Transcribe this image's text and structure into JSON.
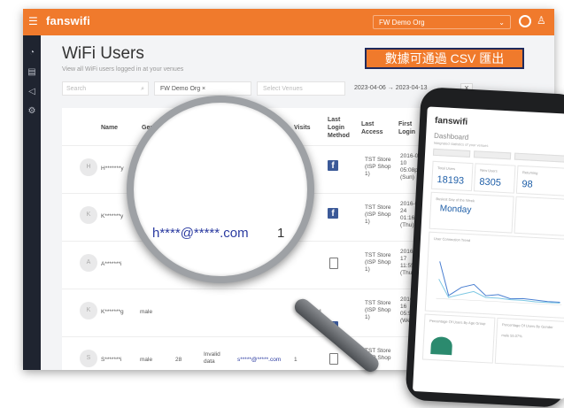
{
  "colors": {
    "brand": "#f07a2c",
    "sidebar": "#1f2430",
    "link": "#2a3aa0",
    "facebook": "#3b5998"
  },
  "topbar": {
    "brand": "fanswifi",
    "org_select": "FW Demo Org",
    "icons": [
      "menu-icon",
      "globe-icon",
      "user-icon"
    ]
  },
  "page": {
    "title": "WiFi Users",
    "subtitle": "View all WiFi users logged in at your venues"
  },
  "banner": "數據可通過 CSV 匯出",
  "filters": {
    "search_placeholder": "Search",
    "org_chip": "FW Demo Org ×",
    "venues_placeholder": "Select Venues",
    "date_range": "2023-04-06 → 2023-04-13",
    "clear": "X"
  },
  "table": {
    "headers": [
      "Name",
      "Gender",
      "Visits",
      "Last Login Method",
      "Last Access",
      "First Login"
    ],
    "rows": [
      {
        "avatar": "H",
        "name": "H*******y",
        "last_access": "TST Store (ISP Shop 1)",
        "first_login": "2016-04-10 05:08pm (Sun)",
        "method": "facebook"
      },
      {
        "avatar": "K",
        "name": "K*******y",
        "last_access": "TST Store (ISP Shop 1)",
        "first_login": "2016-03-24 01:16pm (Thu)",
        "method": "facebook"
      },
      {
        "avatar": "A",
        "name": "A*******i",
        "last_access": "TST Store (ISP Shop 1)",
        "first_login": "2016-03-17 11:55am (Thu)",
        "method": "form"
      },
      {
        "avatar": "K",
        "name": "K*******g",
        "gender": "male",
        "visits": "1",
        "last_access": "TST Store (ISP Shop 1)",
        "first_login": "2016-03-16 05:54pm (Wed)",
        "method": "facebook"
      },
      {
        "avatar": "S",
        "name": "S*******i",
        "gender": "male",
        "age": "28",
        "email_status": "Invalid data",
        "email": "s*****@*****.com",
        "visits": "1",
        "last_access": "TST Store (ISP Shop 1)",
        "method": "form"
      }
    ]
  },
  "magnifier": {
    "email": "h****@*****.com",
    "visits": "1"
  },
  "phone": {
    "brand": "fanswifi",
    "title": "Dashboard",
    "subtitle": "Integrated statistics of your venues",
    "stats": [
      {
        "label": "Total Users",
        "value": "18193"
      },
      {
        "label": "New Users",
        "value": "8305"
      },
      {
        "label": "Returning",
        "value": "98"
      }
    ],
    "busiest_label": "Busiest Day of the Week",
    "busiest_value": "Monday",
    "chart_label": "User Connection Trend",
    "bottom_labels": [
      "Percentage Of Users By Age Group",
      "Percentage Of Users By Gender"
    ],
    "gender_male": "male 55.07%"
  }
}
